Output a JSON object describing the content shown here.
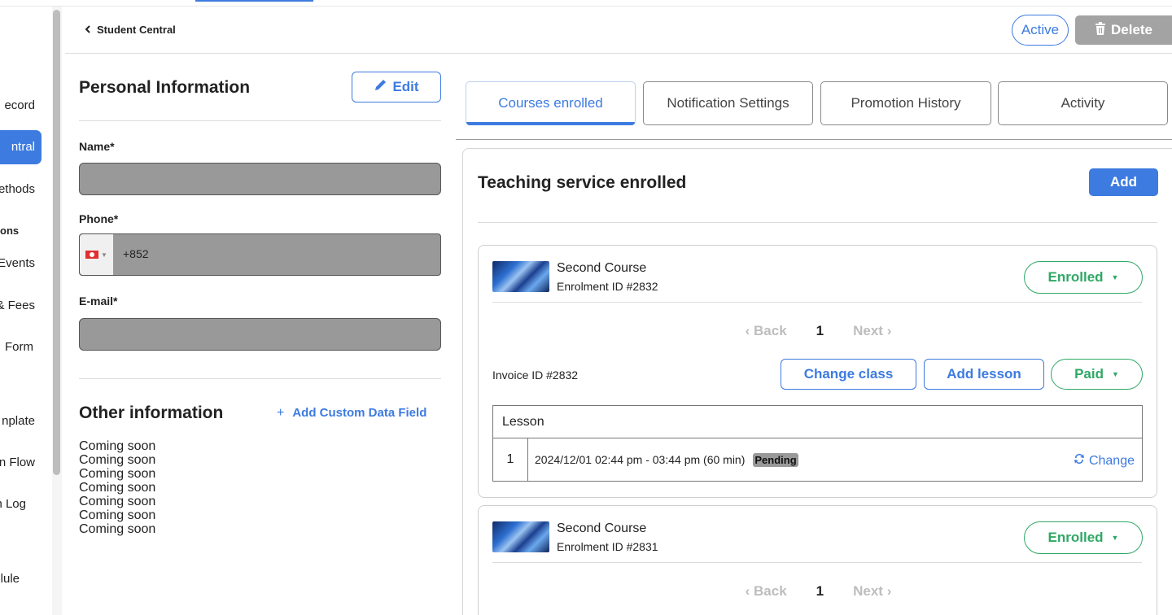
{
  "header": {
    "back_label": "Student Central",
    "status_label": "Active",
    "delete_label": "Delete"
  },
  "sidebar": {
    "items": [
      {
        "label": "ecord"
      },
      {
        "label": "ntral"
      },
      {
        "label": "ethods"
      },
      {
        "label": "ons"
      },
      {
        "label": "Events"
      },
      {
        "label": "& Fees"
      },
      {
        "label": "Form"
      },
      {
        "label": "nplate"
      },
      {
        "label": "n Flow"
      },
      {
        "label": "n Log"
      },
      {
        "label": "lule"
      }
    ]
  },
  "personal": {
    "title": "Personal Information",
    "edit_label": "Edit",
    "name_label": "Name*",
    "phone_label": "Phone*",
    "phone_code": "+852",
    "email_label": "E-mail*"
  },
  "other": {
    "title": "Other information",
    "add_field_label": "Add Custom Data Field",
    "add_field_plus": "+",
    "lines": [
      "Coming soon",
      "Coming soon",
      "Coming soon",
      "Coming soon",
      "Coming soon",
      "Coming soon",
      "Coming soon"
    ]
  },
  "tabs": [
    {
      "label": "Courses enrolled",
      "active": true
    },
    {
      "label": "Notification Settings",
      "active": false
    },
    {
      "label": "Promotion History",
      "active": false
    },
    {
      "label": "Activity",
      "active": false
    }
  ],
  "service": {
    "title": "Teaching service enrolled",
    "add_label": "Add"
  },
  "enrolments": [
    {
      "course": "Second Course",
      "enrolment_id": "Enrolment ID #2832",
      "status": "Enrolled",
      "pager": {
        "back": "Back",
        "page": "1",
        "next": "Next"
      },
      "invoice_id": "Invoice ID #2832",
      "change_class_label": "Change class",
      "add_lesson_label": "Add lesson",
      "payment_status": "Paid",
      "lesson_header": "Lesson",
      "lessons": [
        {
          "num": "1",
          "time": "2024/12/01 02:44 pm - 03:44 pm (60 min)",
          "status": "Pending",
          "action": "Change"
        }
      ]
    },
    {
      "course": "Second Course",
      "enrolment_id": "Enrolment ID #2831",
      "status": "Enrolled",
      "pager": {
        "back": "Back",
        "page": "1",
        "next": "Next"
      }
    }
  ],
  "colors": {
    "accent": "#3d7be0",
    "success": "#2fa865",
    "muted_fill": "#999999"
  }
}
